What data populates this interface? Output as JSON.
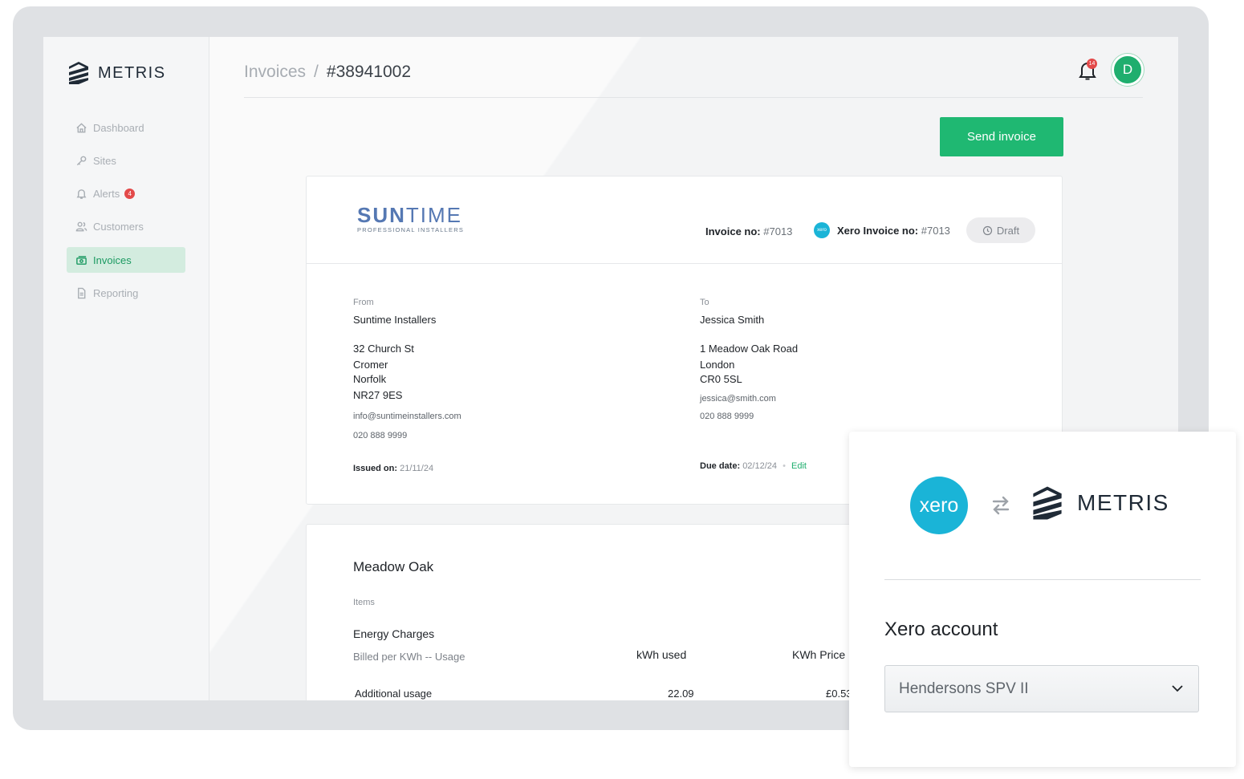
{
  "app": {
    "name": "METRIS"
  },
  "sidebar": {
    "items": [
      {
        "label": "Dashboard",
        "icon": "home-icon"
      },
      {
        "label": "Sites",
        "icon": "key-icon"
      },
      {
        "label": "Alerts",
        "icon": "bell-icon",
        "badge": "4"
      },
      {
        "label": "Customers",
        "icon": "users-icon"
      },
      {
        "label": "Invoices",
        "icon": "cash-icon",
        "active": true
      },
      {
        "label": "Reporting",
        "icon": "document-icon"
      }
    ]
  },
  "header": {
    "breadcrumb": {
      "parent": "Invoices",
      "separator": "/",
      "current": "#38941002"
    },
    "notification_count": "14",
    "avatar_initial": "D"
  },
  "actions": {
    "send_invoice": "Send invoice"
  },
  "invoice": {
    "brand": {
      "name_bold": "SUN",
      "name_light": "TIME",
      "tagline": "PROFESSIONAL INSTALLERS"
    },
    "invoice_no_label": "Invoice no:",
    "invoice_no": "#7013",
    "xero_badge": "xero",
    "xero_invoice_no_label": "Xero Invoice no:",
    "xero_invoice_no": "#7013",
    "status": "Draft",
    "from": {
      "label": "From",
      "name": "Suntime Installers",
      "address": [
        "32 Church St",
        "Cromer",
        "Norfolk",
        "NR27 9ES"
      ],
      "email": "info@suntimeinstallers.com",
      "phone": "020 888 9999"
    },
    "to": {
      "label": "To",
      "name": "Jessica Smith",
      "address": [
        "1 Meadow Oak Road",
        "London",
        "CR0 5SL"
      ],
      "email": "jessica@smith.com",
      "phone": "020 888 9999"
    },
    "issued_label": "Issued on:",
    "issued_on": "21/11/24",
    "due_label": "Due date:",
    "due_date": "02/12/24",
    "bullet": "•",
    "edit_label": "Edit"
  },
  "items_card": {
    "site": "Meadow Oak",
    "items_label": "Items",
    "section_title": "Energy Charges",
    "section_subtitle": "Billed per KWh -- Usage",
    "columns": [
      "kWh used",
      "KWh Price"
    ],
    "rows": [
      {
        "label": "Additional usage",
        "kwh_used": "22.09",
        "kwh_price": "£0.53"
      }
    ]
  },
  "xero_panel": {
    "xero_logo_text": "xero",
    "metris_logo_text": "METRIS",
    "title": "Xero account",
    "selected_account": "Hendersons SPV II"
  },
  "colors": {
    "accent": "#1fb872",
    "xero": "#1ab4d7",
    "badge": "#e34a4a",
    "brand_blue": "#5578b3"
  }
}
